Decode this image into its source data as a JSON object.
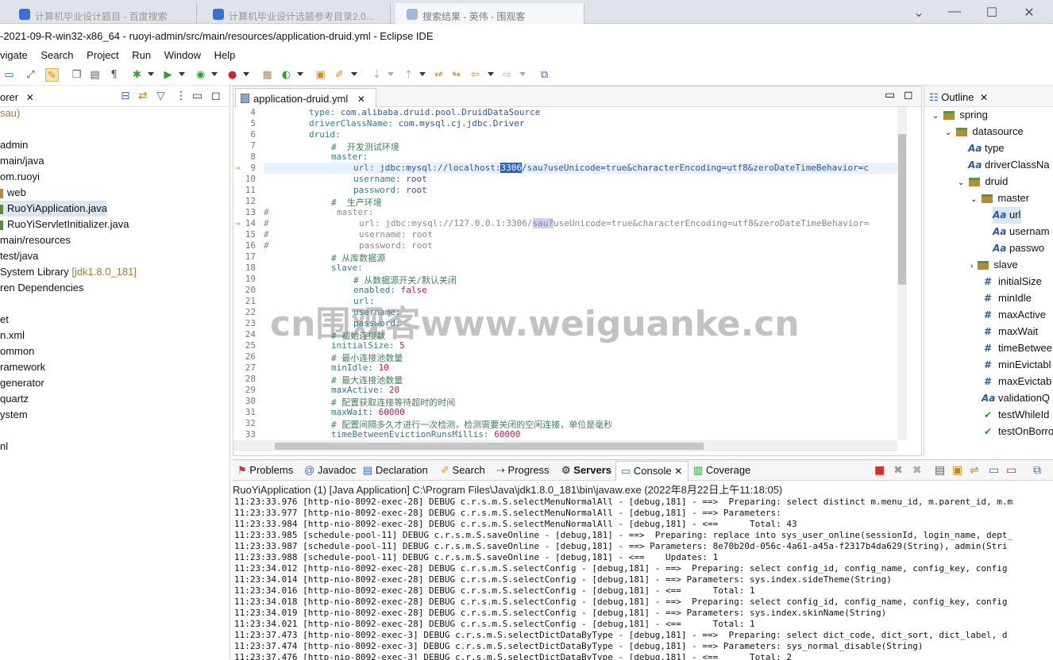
{
  "browser": {
    "tabs": [
      "计算机毕业设计题目 - 百度搜索",
      "计算机毕业设计选题参考目录2.0...",
      "搜索结果 - 英伟 - 围观客"
    ]
  },
  "window": {
    "title": "-2021-09-R-win32-x86_64 - ruoyi-admin/src/main/resources/application-druid.yml - Eclipse IDE"
  },
  "menu": [
    "vigate",
    "Search",
    "Project",
    "Run",
    "Window",
    "Help"
  ],
  "left_panel": {
    "title": "orer",
    "items": [
      {
        "label": "sau)"
      },
      {
        "label": ""
      },
      {
        "label": "admin"
      },
      {
        "label": "main/java"
      },
      {
        "label": "om.ruoyi"
      },
      {
        "label": "web"
      },
      {
        "label": "RuoYiApplication.java"
      },
      {
        "label": "RuoYiServletInitializer.java"
      },
      {
        "label": "main/resources"
      },
      {
        "label": "test/java"
      },
      {
        "label": "System Library",
        "extra": "[jdk1.8.0_181]"
      },
      {
        "label": "ren Dependencies"
      },
      {
        "label": ""
      },
      {
        "label": "et"
      },
      {
        "label": "n.xml"
      },
      {
        "label": "ommon"
      },
      {
        "label": "ramework"
      },
      {
        "label": "generator"
      },
      {
        "label": "quartz"
      },
      {
        "label": "ystem"
      },
      {
        "label": ""
      },
      {
        "label": "nl"
      }
    ]
  },
  "editor": {
    "tab": "application-druid.yml",
    "lines": [
      {
        "n": "4"
      },
      {
        "n": "5"
      },
      {
        "n": "6"
      },
      {
        "n": "7"
      },
      {
        "n": "8"
      },
      {
        "n": "9"
      },
      {
        "n": "10"
      },
      {
        "n": "11"
      },
      {
        "n": "12"
      },
      {
        "n": "13"
      },
      {
        "n": "14"
      },
      {
        "n": "15"
      },
      {
        "n": "16"
      },
      {
        "n": "17"
      },
      {
        "n": "18"
      },
      {
        "n": "19"
      },
      {
        "n": "20"
      },
      {
        "n": "21"
      },
      {
        "n": "22"
      },
      {
        "n": "23"
      },
      {
        "n": "24"
      },
      {
        "n": "25"
      },
      {
        "n": "26"
      },
      {
        "n": "27"
      },
      {
        "n": "28"
      },
      {
        "n": "29"
      },
      {
        "n": "30"
      },
      {
        "n": "31"
      },
      {
        "n": "32"
      },
      {
        "n": "33"
      }
    ],
    "code": {
      "l4k": "type:",
      "l4v": " com.alibaba.druid.pool.DruidDataSource",
      "l5k": "driverClassName:",
      "l5v": " com.mysql.cj.jdbc.Driver",
      "l6k": "druid:",
      "l7c": "#  开发测试环境",
      "l8k": "master:",
      "l9k": "url:",
      "l9a": " jdbc:mysql://localhost:",
      "l9h": "3306",
      "l9b": "/sau?useUnicode=true&characterEncoding=utf8&zeroDateTimeBehavior=c",
      "l10k": "username:",
      "l10v": " root",
      "l11k": "password:",
      "l11v": " root",
      "l12c": "#  生产环境",
      "l13c": "#",
      "l13r": "master:",
      "l14c": "#",
      "l14a": "url: jdbc:mysql://127.0.0.1:3306/",
      "l14h": "sau?",
      "l14b": "useUnicode=true&characterEncoding=utf8&zeroDateTimeBehavior=",
      "l15c": "#",
      "l15r": "username: root",
      "l16c": "#",
      "l16r": "password: root",
      "l17c": "# 从库数据源",
      "l18k": "slave:",
      "l19c": "# 从数据源开关/默认关闭",
      "l20k": "enabled:",
      "l20v": " false",
      "l21k": "url:",
      "l22k": "username:",
      "l23k": "password:",
      "l24c": "# 初始连接数",
      "l25k": "initialSize:",
      "l25v": " 5",
      "l26c": "# 最小连接池数量",
      "l27k": "minIdle:",
      "l27v": " 10",
      "l28c": "# 最大连接池数量",
      "l29k": "maxActive:",
      "l29v": " 20",
      "l30c": "# 配置获取连接等待超时的时间",
      "l31k": "maxWait:",
      "l31v": " 60000",
      "l32c": "# 配置间隔多久才进行一次检测，检测需要关闭的空闲连接，单位是毫秒",
      "l33k": "timeBetweenEvictionRunsMillis:",
      "l33v": " 60000"
    }
  },
  "outline": {
    "title": "Outline",
    "items": [
      {
        "label": "spring"
      },
      {
        "label": "datasource"
      },
      {
        "label": "type"
      },
      {
        "label": "driverClassNa"
      },
      {
        "label": "druid"
      },
      {
        "label": "master"
      },
      {
        "label": "url"
      },
      {
        "label": "usernam"
      },
      {
        "label": "passwo"
      },
      {
        "label": "slave"
      },
      {
        "label": "initialSize"
      },
      {
        "label": "minIdle"
      },
      {
        "label": "maxActive"
      },
      {
        "label": "maxWait"
      },
      {
        "label": "timeBetwee"
      },
      {
        "label": "minEvictabl"
      },
      {
        "label": "maxEvictab"
      },
      {
        "label": "validationQ"
      },
      {
        "label": "testWhileId"
      },
      {
        "label": "testOnBorro"
      }
    ]
  },
  "bottom": {
    "tabs": [
      "Problems",
      "Javadoc",
      "Declaration",
      "Search",
      "Progress",
      "Servers",
      "Console",
      "Coverage"
    ],
    "console_header": "RuoYiApplication (1) [Java Application] C:\\Program Files\\Java\\jdk1.8.0_181\\bin\\javaw.exe  (2022年8月22日上午11:18:05)",
    "lines": [
      "11:23:33.976 [http-nio-8092-exec-28] DEBUG c.r.s.m.S.selectMenuNormalAll - [debug,181] - ==>  Preparing: select distinct m.menu_id, m.parent_id, m.m",
      "11:23:33.977 [http-nio-8092-exec-28] DEBUG c.r.s.m.S.selectMenuNormalAll - [debug,181] - ==> Parameters: ",
      "11:23:33.984 [http-nio-8092-exec-28] DEBUG c.r.s.m.S.selectMenuNormalAll - [debug,181] - <==      Total: 43",
      "11:23:33.985 [schedule-pool-11] DEBUG c.r.s.m.S.saveOnline - [debug,181] - ==>  Preparing: replace into sys_user_online(sessionId, login_name, dept_",
      "11:23:33.987 [schedule-pool-11] DEBUG c.r.s.m.S.saveOnline - [debug,181] - ==> Parameters: 8e70b20d-056c-4a61-a45a-f2317b4da629(String), admin(Stri",
      "11:23:33.988 [schedule-pool-11] DEBUG c.r.s.m.S.saveOnline - [debug,181] - <==    Updates: 1",
      "11:23:34.012 [http-nio-8092-exec-28] DEBUG c.r.s.m.S.selectConfig - [debug,181] - ==>  Preparing: select config_id, config_name, config_key, config",
      "11:23:34.014 [http-nio-8092-exec-28] DEBUG c.r.s.m.S.selectConfig - [debug,181] - ==> Parameters: sys.index.sideTheme(String)",
      "11:23:34.016 [http-nio-8092-exec-28] DEBUG c.r.s.m.S.selectConfig - [debug,181] - <==      Total: 1",
      "11:23:34.018 [http-nio-8092-exec-28] DEBUG c.r.s.m.S.selectConfig - [debug,181] - ==>  Preparing: select config_id, config_name, config_key, config",
      "11:23:34.019 [http-nio-8092-exec-28] DEBUG c.r.s.m.S.selectConfig - [debug,181] - ==> Parameters: sys.index.skinName(String)",
      "11:23:34.021 [http-nio-8092-exec-28] DEBUG c.r.s.m.S.selectConfig - [debug,181] - <==      Total: 1",
      "11:23:37.473 [http-nio-8092-exec-3] DEBUG c.r.s.m.S.selectDictDataByType - [debug,181] - ==>  Preparing: select dict_code, dict_sort, dict_label, d",
      "11:23:37.474 [http-nio-8092-exec-3] DEBUG c.r.s.m.S.selectDictDataByType - [debug,181] - ==> Parameters: sys_normal_disable(String)",
      "11:23:37.476 [http-nio-8092-exec-3] DEBUG c.r.s.m.S.selectDictDataByType - [debug,181] - <==      Total: 2"
    ]
  },
  "watermark": "cn围观客www.weiguanke.cn",
  "colors": {
    "selection": "#2b63c9",
    "terminate": "#d32f2f",
    "keyword": "#2a7f8a",
    "value": "#2a52be",
    "comment": "#3f7f5f",
    "number": "#c2185b"
  }
}
